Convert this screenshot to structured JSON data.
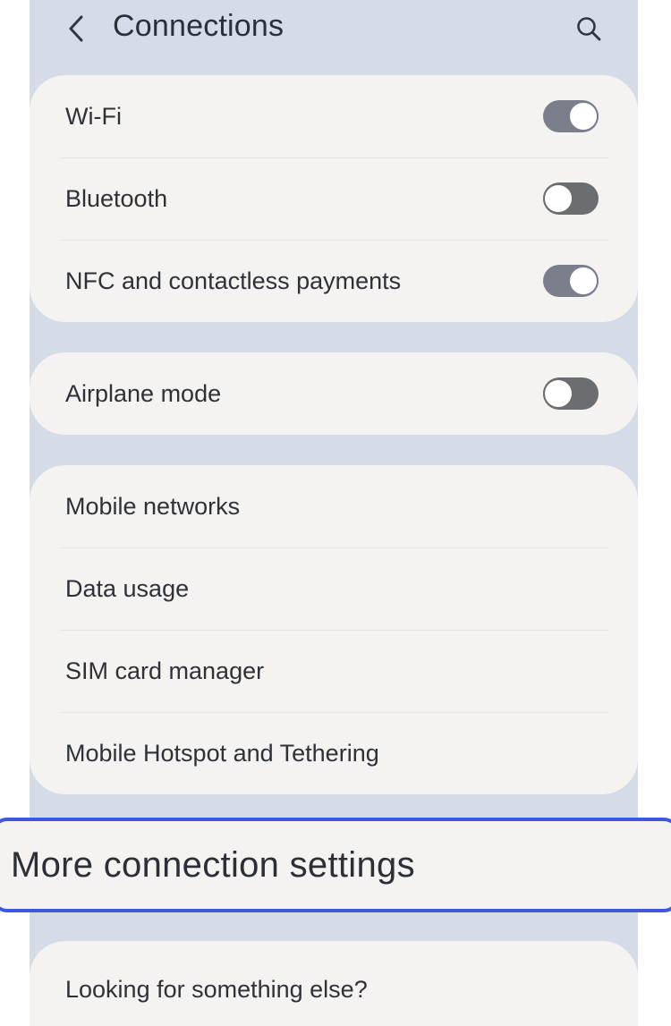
{
  "header": {
    "title": "Connections",
    "back_icon": "chevron-left-icon",
    "search_icon": "search-icon"
  },
  "group1": {
    "items": [
      {
        "label": "Wi-Fi",
        "toggle": "on"
      },
      {
        "label": "Bluetooth",
        "toggle": "off"
      },
      {
        "label": "NFC and contactless payments",
        "toggle": "on"
      }
    ]
  },
  "group2": {
    "items": [
      {
        "label": "Airplane mode",
        "toggle": "off"
      }
    ]
  },
  "group3": {
    "items": [
      {
        "label": "Mobile networks"
      },
      {
        "label": "Data usage"
      },
      {
        "label": "SIM card manager"
      },
      {
        "label": "Mobile Hotspot and Tethering"
      }
    ]
  },
  "highlighted": {
    "label": "More connection settings",
    "border_color": "#3e57dd"
  },
  "group4": {
    "items": [
      {
        "label": "Looking for something else?"
      }
    ]
  },
  "colors": {
    "background": "#d5dce8",
    "card": "#f4f3f1",
    "toggle_on": "#7b7f8c",
    "toggle_off": "#6b6d70"
  }
}
